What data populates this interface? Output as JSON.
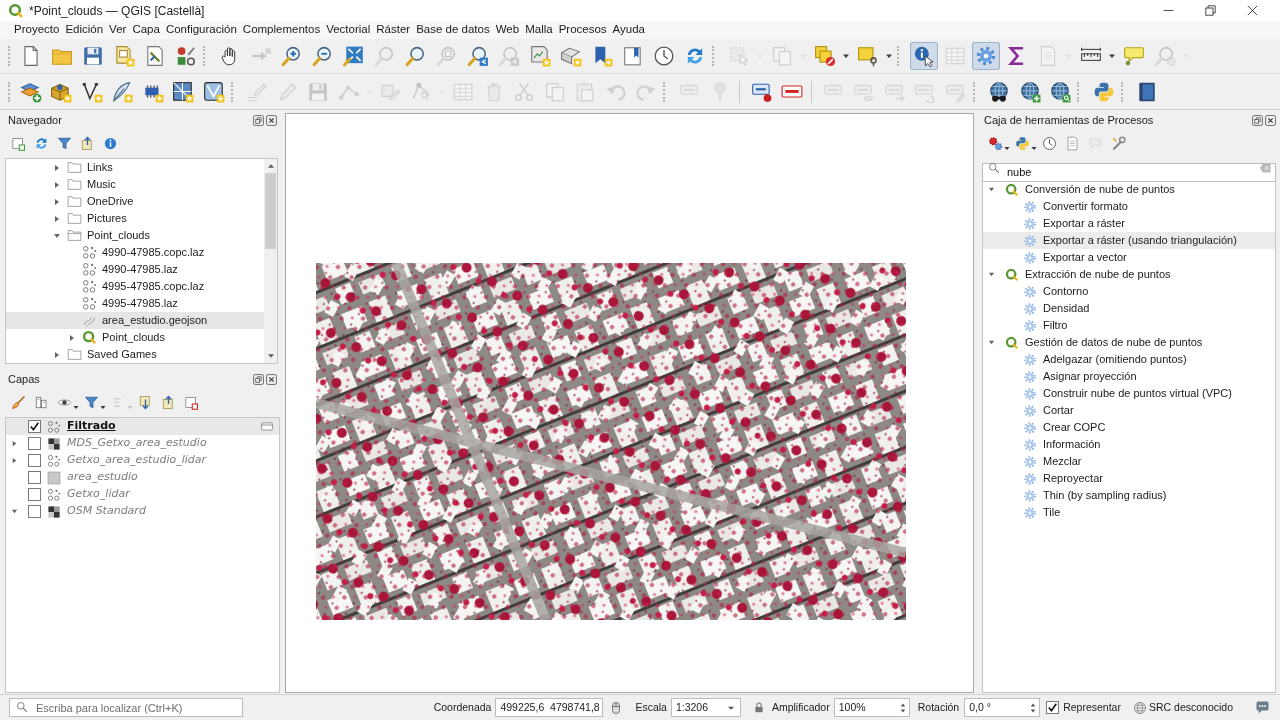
{
  "window": {
    "title": "*Point_clouds — QGIS [Castellà]"
  },
  "menu_bar": [
    "Proyecto",
    "Edición",
    "Ver",
    "Capa",
    "Configuración",
    "Complementos",
    "Vectorial",
    "Ráster",
    "Base de datos",
    "Web",
    "Malla",
    "Procesos",
    "Ayuda"
  ],
  "toolbars": [
    [
      {
        "handle": true,
        "items": [
          {
            "kind": "blank-page",
            "disabled": false,
            "pressed": false
          },
          {
            "kind": "folder",
            "disabled": false,
            "pressed": false
          },
          {
            "kind": "floppy-disk",
            "disabled": false,
            "pressed": false
          },
          {
            "kind": "page-star",
            "disabled": false,
            "pressed": false
          },
          {
            "kind": "page-wrench",
            "disabled": false,
            "pressed": false
          },
          {
            "kind": "style-shapes",
            "disabled": false,
            "pressed": false
          }
        ]
      },
      {
        "handle": true,
        "items": [
          {
            "kind": "hand",
            "disabled": false,
            "pressed": false
          },
          {
            "kind": "arrow-pan",
            "disabled": true,
            "pressed": false
          },
          {
            "kind": "zoom-in",
            "disabled": false,
            "pressed": false
          },
          {
            "kind": "zoom-out",
            "disabled": false,
            "pressed": false
          },
          {
            "kind": "zoom-full",
            "disabled": false,
            "pressed": false
          },
          {
            "kind": "magnifier",
            "disabled": true,
            "pressed": false
          },
          {
            "kind": "magnifier",
            "disabled": false,
            "pressed": false
          },
          {
            "kind": "magnifier-square",
            "disabled": true,
            "pressed": false
          },
          {
            "kind": "magnifier-arrow",
            "disabled": false,
            "pressed": false
          },
          {
            "kind": "magnifier-arrow",
            "disabled": true,
            "pressed": false
          },
          {
            "kind": "map-star",
            "disabled": false,
            "pressed": false
          },
          {
            "kind": "map-3d-star",
            "disabled": false,
            "pressed": false
          },
          {
            "kind": "bookmark-star",
            "disabled": false,
            "pressed": false
          },
          {
            "kind": "bookmark-list",
            "disabled": false,
            "pressed": false
          },
          {
            "kind": "clock",
            "disabled": false,
            "pressed": false
          },
          {
            "kind": "refresh",
            "disabled": false,
            "pressed": false
          }
        ]
      },
      {
        "handle": true,
        "items": [
          {
            "kind": "selection-box",
            "disabled": true,
            "pressed": false
          },
          {
            "kind": "caret",
            "disabled": true,
            "pressed": false
          },
          {
            "kind": "copy-pages",
            "disabled": true,
            "pressed": false
          },
          {
            "kind": "caret",
            "disabled": true,
            "pressed": false
          },
          {
            "kind": "squares-cancel",
            "disabled": false,
            "pressed": false
          },
          {
            "kind": "caret",
            "disabled": false,
            "pressed": false
          },
          {
            "kind": "square-pin",
            "disabled": false,
            "pressed": false
          },
          {
            "kind": "caret",
            "disabled": false,
            "pressed": false
          }
        ]
      },
      {
        "handle": true,
        "items": [
          {
            "kind": "info-cursor",
            "disabled": false,
            "pressed": true
          },
          {
            "kind": "table",
            "disabled": true,
            "pressed": false
          },
          {
            "kind": "gear",
            "disabled": false,
            "pressed": true
          },
          {
            "kind": "sigma",
            "disabled": false,
            "pressed": false
          },
          {
            "kind": "page-lines",
            "disabled": true,
            "pressed": false
          },
          {
            "kind": "caret",
            "disabled": true,
            "pressed": false
          },
          {
            "kind": "ruler",
            "disabled": false,
            "pressed": false
          },
          {
            "kind": "caret",
            "disabled": false,
            "pressed": false
          },
          {
            "kind": "speech-bubble",
            "disabled": false,
            "pressed": false
          },
          {
            "kind": "magnifier-gear",
            "disabled": true,
            "pressed": false
          },
          {
            "kind": "caret",
            "disabled": true,
            "pressed": false
          }
        ]
      }
    ],
    [
      {
        "handle": true,
        "items": [
          {
            "kind": "layers-plus",
            "disabled": false,
            "pressed": false
          },
          {
            "kind": "box-star",
            "disabled": false,
            "pressed": false
          },
          {
            "kind": "vertex-star",
            "disabled": false,
            "pressed": false
          },
          {
            "kind": "feather-star",
            "disabled": false,
            "pressed": false
          },
          {
            "kind": "chip-star",
            "disabled": false,
            "pressed": false
          },
          {
            "kind": "grid-star",
            "disabled": false,
            "pressed": false
          },
          {
            "kind": "mesh-star",
            "disabled": false,
            "pressed": false
          }
        ]
      },
      {
        "handle": true,
        "items": [
          {
            "kind": "pencil-lines",
            "disabled": true,
            "pressed": false
          },
          {
            "kind": "pencil",
            "disabled": true,
            "pressed": false
          },
          {
            "kind": "floppy-disk",
            "disabled": true,
            "pressed": false
          },
          {
            "kind": "node-dots",
            "disabled": true,
            "pressed": false
          },
          {
            "kind": "caret",
            "disabled": true,
            "pressed": false
          },
          {
            "kind": "shape-pencil",
            "disabled": true,
            "pressed": false
          },
          {
            "kind": "vertex-tool",
            "disabled": true,
            "pressed": false
          },
          {
            "kind": "caret",
            "disabled": true,
            "pressed": false
          },
          {
            "kind": "table",
            "disabled": true,
            "pressed": false
          },
          {
            "kind": "trash",
            "disabled": true,
            "pressed": false
          },
          {
            "kind": "scissors",
            "disabled": true,
            "pressed": false
          },
          {
            "kind": "copy-pages",
            "disabled": true,
            "pressed": false
          },
          {
            "kind": "paste-page",
            "disabled": true,
            "pressed": false
          },
          {
            "kind": "undo",
            "disabled": true,
            "pressed": false
          },
          {
            "kind": "redo",
            "disabled": true,
            "pressed": false
          }
        ]
      },
      {
        "handle": true,
        "items": [
          {
            "kind": "label-tag",
            "disabled": true,
            "pressed": false
          },
          {
            "kind": "pushpin",
            "disabled": true,
            "pressed": false
          }
        ]
      },
      {
        "handle": false,
        "items": [
          {
            "kind": "label-dot",
            "disabled": false,
            "pressed": false
          },
          {
            "kind": "label-crossed",
            "disabled": false,
            "pressed": false
          }
        ]
      },
      {
        "handle": false,
        "items": [
          {
            "kind": "label-tag",
            "disabled": true,
            "pressed": false
          },
          {
            "kind": "label-eye",
            "disabled": true,
            "pressed": false
          },
          {
            "kind": "label-arrow",
            "disabled": true,
            "pressed": false
          },
          {
            "kind": "label-rotate",
            "disabled": true,
            "pressed": false
          },
          {
            "kind": "label-pencil",
            "disabled": true,
            "pressed": false
          }
        ]
      },
      {
        "handle": true,
        "items": [
          {
            "kind": "globe-binoculars",
            "disabled": false,
            "pressed": false
          },
          {
            "kind": "globe-plus",
            "disabled": false,
            "pressed": false
          },
          {
            "kind": "globe-magnifier",
            "disabled": false,
            "pressed": false
          }
        ]
      },
      {
        "handle": true,
        "items": [
          {
            "kind": "python",
            "disabled": false,
            "pressed": false
          }
        ]
      },
      {
        "handle": true,
        "items": [
          {
            "kind": "book",
            "disabled": false,
            "pressed": false
          }
        ]
      }
    ]
  ],
  "navigator": {
    "title": "Navegador",
    "toolbar": [
      {
        "kind": "page-plus",
        "disabled": false
      },
      {
        "kind": "refresh",
        "disabled": false
      },
      {
        "kind": "funnel",
        "disabled": false
      },
      {
        "kind": "collapse-tree",
        "disabled": false
      },
      {
        "kind": "info",
        "disabled": false
      }
    ],
    "tree": [
      {
        "label": "Links",
        "kind": "folder",
        "expanded": false,
        "selected": false
      },
      {
        "label": "Music",
        "kind": "folder",
        "expanded": false,
        "selected": false
      },
      {
        "label": "OneDrive",
        "kind": "folder",
        "expanded": false,
        "selected": false
      },
      {
        "label": "Pictures",
        "kind": "folder",
        "expanded": false,
        "selected": false
      },
      {
        "label": "Point_clouds",
        "kind": "folder",
        "expanded": true,
        "selected": false,
        "children": [
          {
            "label": "4990-47985.copc.laz",
            "kind": "point-cloud",
            "selected": false
          },
          {
            "label": "4990-47985.laz",
            "kind": "point-cloud",
            "selected": false
          },
          {
            "label": "4995-47985.copc.laz",
            "kind": "point-cloud",
            "selected": false
          },
          {
            "label": "4995-47985.laz",
            "kind": "point-cloud",
            "selected": false
          },
          {
            "label": "area_estudio.geojson",
            "kind": "vector",
            "selected": true
          },
          {
            "label": "Point_clouds",
            "kind": "project",
            "expanded": false,
            "selected": false
          }
        ]
      },
      {
        "label": "Saved Games",
        "kind": "folder",
        "expanded": false,
        "selected": false
      }
    ]
  },
  "layers": {
    "title": "Capas",
    "toolbar": [
      {
        "kind": "brush",
        "disabled": false
      },
      {
        "kind": "group-add",
        "disabled": false
      },
      {
        "kind": "eye",
        "disabled": false
      },
      {
        "kind": "caret",
        "disabled": false
      },
      {
        "kind": "funnel",
        "disabled": false
      },
      {
        "kind": "caret",
        "disabled": false
      },
      {
        "kind": "expression",
        "disabled": true
      },
      {
        "kind": "caret",
        "disabled": true
      },
      {
        "kind": "expand-tree",
        "disabled": false
      },
      {
        "kind": "collapse-tree",
        "disabled": false
      },
      {
        "kind": "page-remove",
        "disabled": false
      }
    ],
    "items": [
      {
        "label": "Filtrado",
        "kind": "point-cloud",
        "checked": true,
        "selected": true,
        "filtered": true
      },
      {
        "label": "MDS_Getxo_area_estudio",
        "kind": "raster",
        "checked": false,
        "selected": false,
        "filtered": false,
        "expanded": false
      },
      {
        "label": "Getxo_area_estudio_lidar",
        "kind": "point-cloud",
        "checked": false,
        "selected": false,
        "filtered": false,
        "expanded": false
      },
      {
        "label": "area_estudio",
        "kind": "polygon",
        "checked": false,
        "selected": false,
        "filtered": false
      },
      {
        "label": "Getxo_lidar",
        "kind": "point-cloud",
        "checked": false,
        "selected": false,
        "filtered": false
      },
      {
        "label": "OSM Standard",
        "kind": "raster",
        "checked": false,
        "selected": false,
        "filtered": false,
        "expanded": true
      }
    ]
  },
  "processing": {
    "title": "Caja de herramientas de Procesos",
    "toolbar": [
      {
        "kind": "gears",
        "disabled": false
      },
      {
        "kind": "caret",
        "disabled": false
      },
      {
        "kind": "python",
        "disabled": false
      },
      {
        "kind": "caret",
        "disabled": false
      },
      {
        "kind": "clock",
        "disabled": false
      },
      {
        "kind": "page-lines",
        "disabled": false
      },
      {
        "kind": "comment",
        "disabled": true
      },
      {
        "kind": "wrench",
        "disabled": false
      }
    ],
    "search": {
      "value": "nube"
    },
    "groups": [
      {
        "label": "Conversión de nube de puntos",
        "expanded": true,
        "selected": false,
        "children": [
          {
            "label": "Convertir formato",
            "selected": false
          },
          {
            "label": "Exportar a ráster",
            "selected": false
          },
          {
            "label": "Exportar a ráster (usando triangulación)",
            "selected": true
          },
          {
            "label": "Exportar a vector",
            "selected": false
          }
        ]
      },
      {
        "label": "Extracción de nube de puntos",
        "expanded": true,
        "selected": false,
        "children": [
          {
            "label": "Contorno",
            "selected": false
          },
          {
            "label": "Densidad",
            "selected": false
          },
          {
            "label": "Filtro",
            "selected": false
          }
        ]
      },
      {
        "label": "Gestión de datos de nube de puntos",
        "expanded": true,
        "selected": false,
        "children": [
          {
            "label": "Adelgazar (omitiendo puntos)",
            "selected": false
          },
          {
            "label": "Asignar proyección",
            "selected": false
          },
          {
            "label": "Construir nube de puntos virtual (VPC)",
            "selected": false
          },
          {
            "label": "Cortar",
            "selected": false
          },
          {
            "label": "Crear COPC",
            "selected": false
          },
          {
            "label": "Información",
            "selected": false
          },
          {
            "label": "Mezclar",
            "selected": false
          },
          {
            "label": "Reproyectar",
            "selected": false
          },
          {
            "label": "Thin (by sampling radius)",
            "selected": false
          },
          {
            "label": "Tile",
            "selected": false
          }
        ]
      }
    ]
  },
  "status_bar": {
    "locator": {
      "placeholder": "Escriba para localizar (Ctrl+K)"
    },
    "coordinate": {
      "label": "Coordenada",
      "value": "499225,6  4798741,8"
    },
    "scale": {
      "label": "Escala",
      "value": "1:3206"
    },
    "magnifier": {
      "label": "Amplificador",
      "value": "100%"
    },
    "rotation": {
      "label": "Rotación",
      "value": "0,0 °"
    },
    "render": {
      "label": "Representar",
      "checked": true
    },
    "crs": {
      "label": "SRC desconocido"
    }
  }
}
